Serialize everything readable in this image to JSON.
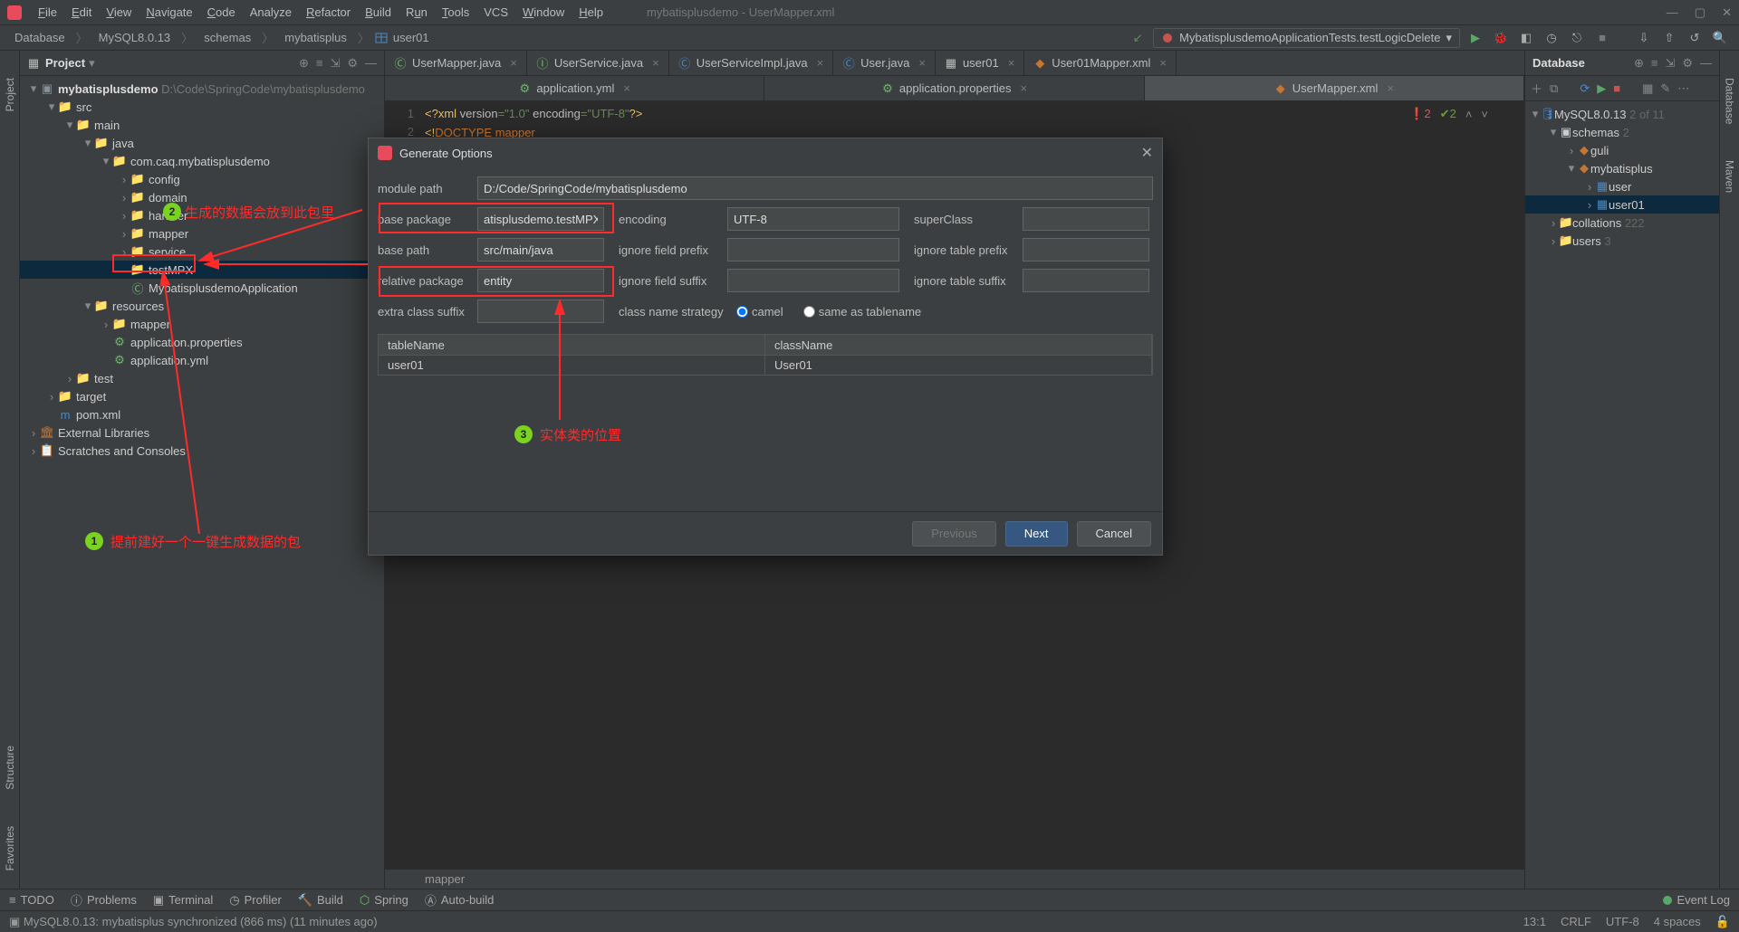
{
  "menu": {
    "file": "File",
    "edit": "Edit",
    "view": "View",
    "navigate": "Navigate",
    "code": "Code",
    "analyze": "Analyze",
    "refactor": "Refactor",
    "build": "Build",
    "run": "Run",
    "tools": "Tools",
    "vcs": "VCS",
    "window": "Window",
    "help": "Help",
    "title": "mybatisplusdemo - UserMapper.xml"
  },
  "breadcrumbs": [
    "Database",
    "MySQL8.0.13",
    "schemas",
    "mybatisplus",
    "user01"
  ],
  "runconfig": "MybatisplusdemoApplicationTests.testLogicDelete",
  "project": {
    "title": "Project",
    "root": {
      "name": "mybatisplusdemo",
      "path": "D:\\Code\\SpringCode\\mybatisplusdemo"
    },
    "nodes": {
      "src": "src",
      "main": "main",
      "java": "java",
      "pkg": "com.caq.mybatisplusdemo",
      "config": "config",
      "domain": "domain",
      "handler": "handler",
      "mapper": "mapper",
      "service": "service",
      "testmpx": "testMPX",
      "appclass": "MybatisplusdemoApplication",
      "resources": "resources",
      "resmapper": "mapper",
      "appprops": "application.properties",
      "appyml": "application.yml",
      "test": "test",
      "target": "target",
      "pom": "pom.xml",
      "extlib": "External Libraries",
      "scratch": "Scratches and Consoles"
    }
  },
  "tabs_row1": [
    {
      "label": "UserMapper.java",
      "icon": "class"
    },
    {
      "label": "UserService.java",
      "icon": "interface"
    },
    {
      "label": "UserServiceImpl.java",
      "icon": "class"
    },
    {
      "label": "User.java",
      "icon": "class"
    },
    {
      "label": "user01",
      "icon": "table"
    },
    {
      "label": "User01Mapper.xml",
      "icon": "xml"
    }
  ],
  "tabs_row2": [
    {
      "label": "application.yml",
      "close": "×"
    },
    {
      "label": "application.properties",
      "close": "×"
    },
    {
      "label": "UserMapper.xml",
      "close": "×",
      "active": true
    }
  ],
  "code": {
    "l1a": "<?",
    "l1b": "xml ",
    "l1c": "version",
    "l1d": "=\"1.0\" ",
    "l1e": "encoding",
    "l1f": "=\"UTF-8\"",
    "l1g": "?>",
    "l2a": "<!",
    "l2b": "DOCTYPE ",
    "l2c": "mapper",
    "badges": {
      "err": "2",
      "ok": "2"
    }
  },
  "crumbbar": "mapper",
  "dialog": {
    "title": "Generate Options",
    "labels": {
      "module_path": "module path",
      "base_package": "base package",
      "encoding": "encoding",
      "superclass": "superClass",
      "base_path": "base path",
      "ignore_field_prefix": "ignore field prefix",
      "ignore_table_prefix": "ignore table prefix",
      "relative_package": "relative package",
      "ignore_field_suffix": "ignore field suffix",
      "ignore_table_suffix": "ignore table suffix",
      "extra_class_suffix": "extra class suffix",
      "class_name_strategy": "class name strategy",
      "camel": "camel",
      "same": "same as tablename"
    },
    "values": {
      "module_path": "D:/Code/SpringCode/mybatisplusdemo",
      "base_package": "atisplusdemo.testMPX",
      "encoding": "UTF-8",
      "superclass": "",
      "base_path": "src/main/java",
      "ignore_field_prefix": "",
      "ignore_table_prefix": "",
      "relative_package": "entity",
      "ignore_field_suffix": "",
      "ignore_table_suffix": "",
      "extra_class_suffix": ""
    },
    "table": {
      "h1": "tableName",
      "h2": "className",
      "r1c1": "user01",
      "r1c2": "User01"
    },
    "buttons": {
      "prev": "Previous",
      "next": "Next",
      "cancel": "Cancel"
    }
  },
  "dbpanel": {
    "title": "Database",
    "root": "MySQL8.0.13",
    "rootcount": "2 of 11",
    "schemas": "schemas",
    "schemas_n": "2",
    "guli": "guli",
    "mybatisplus": "mybatisplus",
    "user": "user",
    "user01": "user01",
    "collations": "collations",
    "collations_n": "222",
    "users": "users",
    "users_n": "3"
  },
  "bottombar": {
    "todo": "TODO",
    "problems": "Problems",
    "terminal": "Terminal",
    "profiler": "Profiler",
    "build": "Build",
    "spring": "Spring",
    "autobuild": "Auto-build",
    "eventlog": "Event Log"
  },
  "statusbar": {
    "msg": "MySQL8.0.13: mybatisplus synchronized (866 ms) (11 minutes ago)",
    "pos": "13:1",
    "crlf": "CRLF",
    "enc": "UTF-8",
    "indent": "4 spaces"
  },
  "sidelabels": {
    "project": "Project",
    "structure": "Structure",
    "favorites": "Favorites",
    "maven": "Maven",
    "database": "Database"
  },
  "annotations": {
    "a1": "提前建好一个一键生成数据的包",
    "a2": "生成的数据会放到此包里",
    "a3": "实体类的位置",
    "n1": "1",
    "n2": "2",
    "n3": "3"
  }
}
